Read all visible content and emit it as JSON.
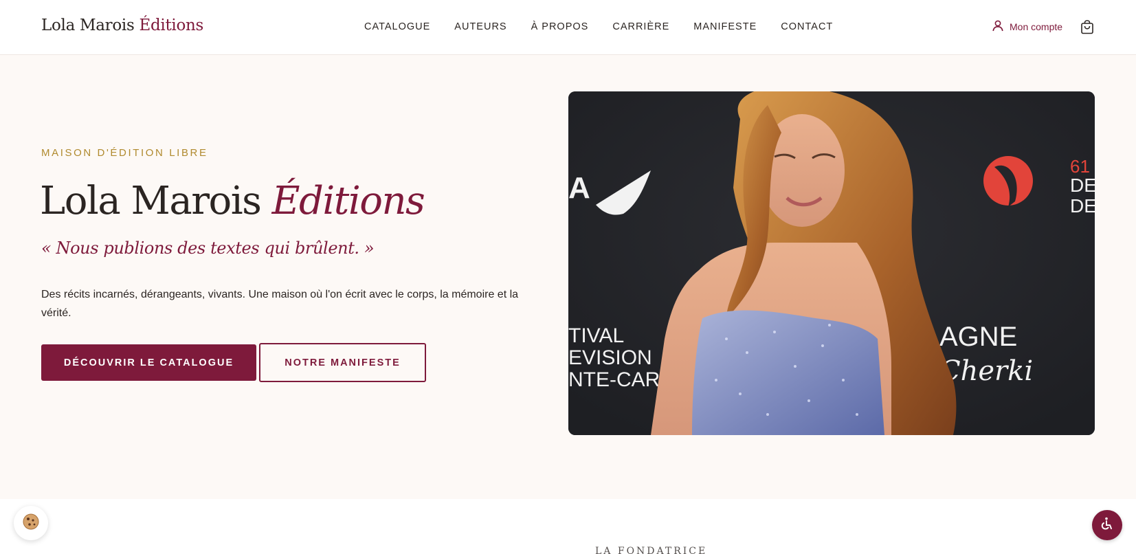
{
  "header": {
    "logo_main": "Lola Marois ",
    "logo_accent": "Éditions",
    "nav": [
      {
        "label": "CATALOGUE"
      },
      {
        "label": "AUTEURS"
      },
      {
        "label": "À PROPOS"
      },
      {
        "label": "CARRIÈRE"
      },
      {
        "label": "MANIFESTE"
      },
      {
        "label": "CONTACT"
      }
    ],
    "account_label": "Mon compte",
    "account_icon": "user-icon",
    "cart_icon": "cart-icon"
  },
  "hero": {
    "eyebrow": "MAISON D'ÉDITION LIBRE",
    "title_main": "Lola Marois ",
    "title_accent": "Éditions",
    "tagline": "« Nous publions des textes qui brûlent. »",
    "description": "Des récits incarnés, dérangeants, vivants. Une maison où l'on écrit avec le corps, la mémoire et la vérité.",
    "primary_button": "DÉCOUVRIR LE CATALOGUE",
    "secondary_button": "NOTRE MANIFESTE",
    "photo_backdrop_text": {
      "left_top": "A",
      "left_lines": [
        "TIVAL",
        "EVISION",
        "NTE-CARLO"
      ],
      "right_top": [
        "61",
        "DE",
        "DE"
      ],
      "right_lines": [
        "AGNE",
        "Cherki"
      ]
    }
  },
  "lower": {
    "heading": "LA FONDATRICE"
  },
  "widgets": {
    "cookie_icon": "cookie-icon",
    "accessibility_icon": "accessibility-icon"
  },
  "colors": {
    "accent": "#7e1a3b",
    "gold": "#b08a2e",
    "background": "#fdf9f6",
    "text": "#2b2522"
  }
}
